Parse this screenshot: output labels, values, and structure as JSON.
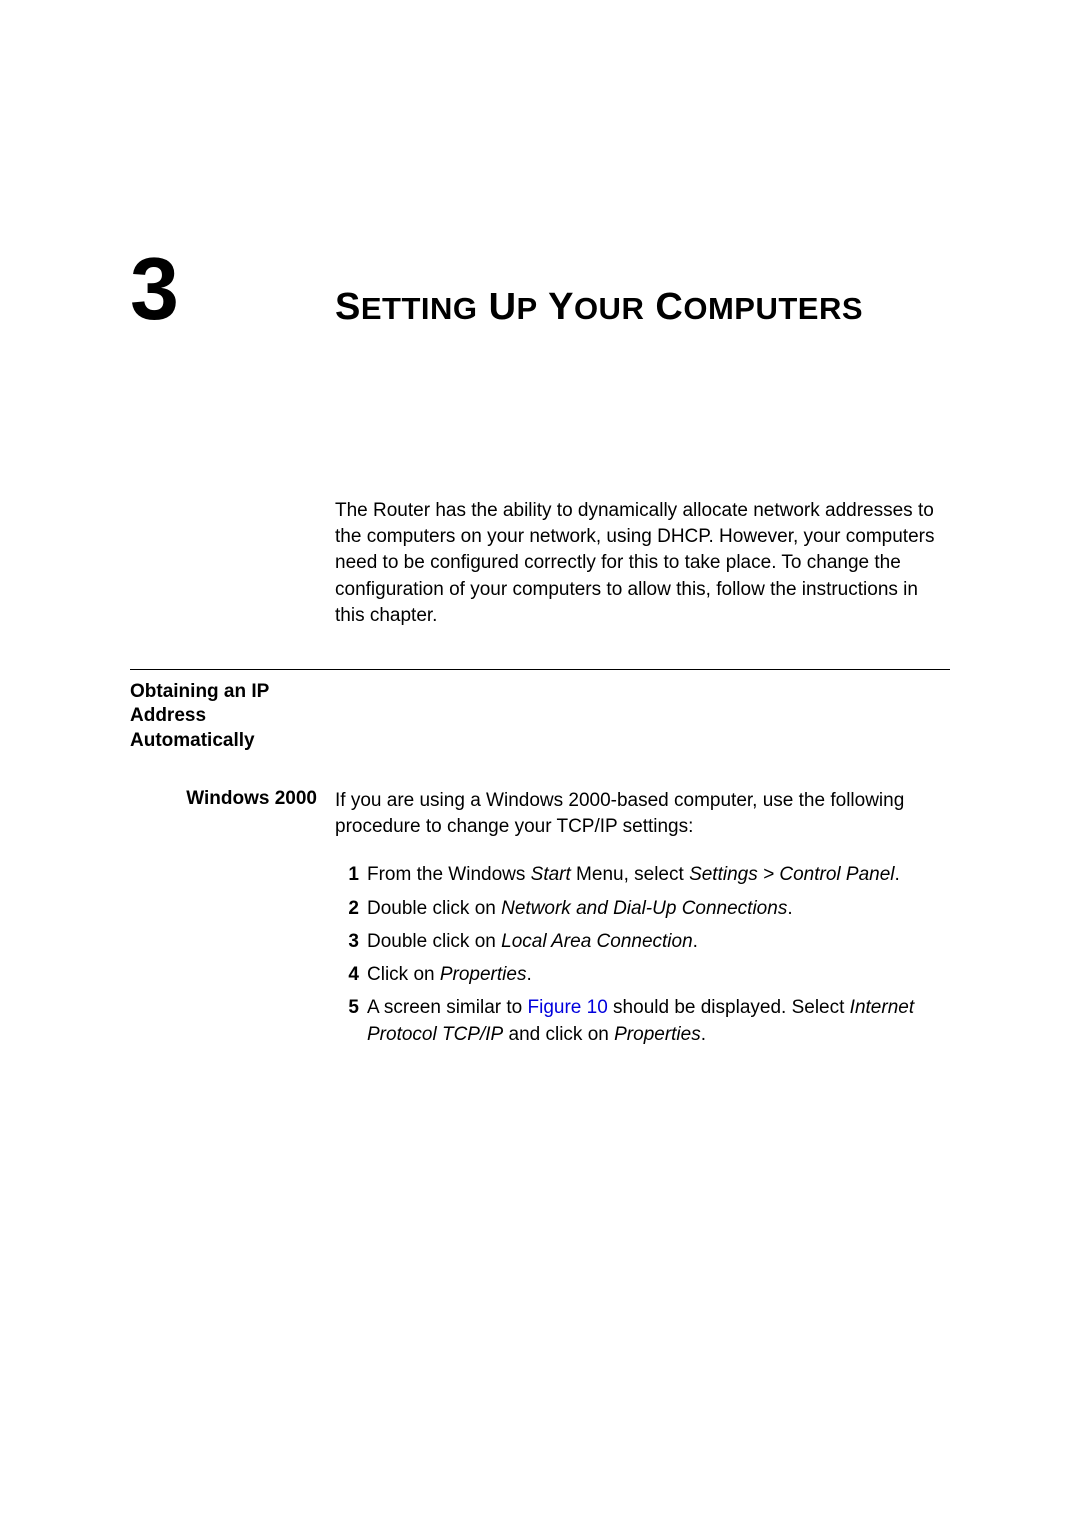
{
  "chapter": {
    "number": "3",
    "title_parts": [
      "S",
      "ETTING",
      " U",
      "P",
      " Y",
      "OUR",
      " C",
      "OMPUTERS"
    ]
  },
  "intro": "The Router has the ability to dynamically allocate network addresses to the computers on your network, using DHCP. However, your computers need to be configured correctly for this to take place. To change the configuration of your computers to allow this, follow the instructions in this chapter.",
  "section": {
    "heading_line1": "Obtaining an IP",
    "heading_line2": "Address",
    "heading_line3": "Automatically",
    "sub_heading": "Windows 2000",
    "sub_intro": "If you are using a Windows 2000-based computer, use the following procedure to change your TCP/IP settings:",
    "steps": {
      "1": {
        "prefix": "From the Windows ",
        "i1": "Start",
        "mid1": " Menu, select ",
        "i2": "Settings > Control Panel",
        "suffix": "."
      },
      "2": {
        "prefix": "Double click on ",
        "i1": "Network and Dial-Up Connections",
        "suffix": "."
      },
      "3": {
        "prefix": "Double click on ",
        "i1": "Local Area Connection",
        "suffix": "."
      },
      "4": {
        "prefix": "Click on ",
        "i1": "Properties",
        "suffix": "."
      },
      "5": {
        "prefix": "A screen similar to ",
        "link": "Figure 10",
        "mid1": " should be displayed. Select ",
        "i1": "Internet Protocol TCP/IP",
        "mid2": " and click on ",
        "i2": "Properties",
        "suffix": "."
      }
    }
  }
}
